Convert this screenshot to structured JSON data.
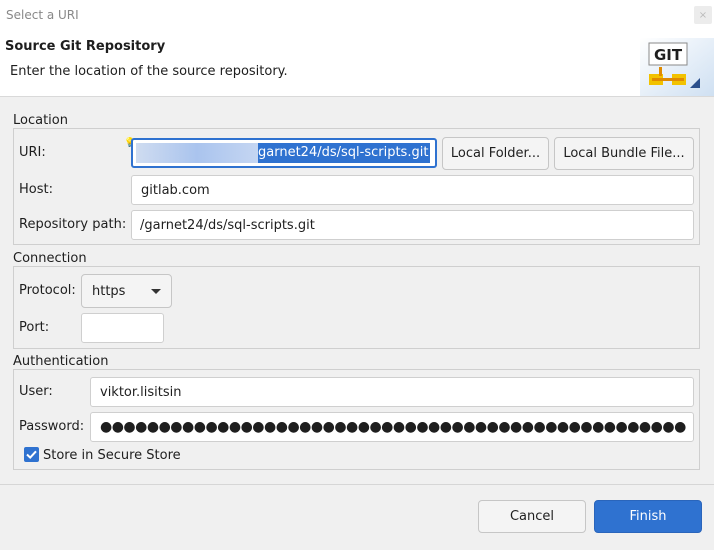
{
  "window": {
    "title": "Select a URI",
    "close_glyph": "×"
  },
  "banner": {
    "heading": "Source Git Repository",
    "description": "Enter the location of the source repository.",
    "logo_text": "GIT",
    "logo_icon": "git-logo-icon"
  },
  "location": {
    "group_title": "Location",
    "uri_label": "URI:",
    "uri_value": "garnet24/ds/sql-scripts.git",
    "local_folder_label": "Local Folder...",
    "local_bundle_label": "Local Bundle File...",
    "host_label": "Host:",
    "host_value": "gitlab.com",
    "repo_path_label": "Repository path:",
    "repo_path_value": "/garnet24/ds/sql-scripts.git"
  },
  "connection": {
    "group_title": "Connection",
    "protocol_label": "Protocol:",
    "protocol_value": "https",
    "port_label": "Port:",
    "port_value": ""
  },
  "authentication": {
    "group_title": "Authentication",
    "user_label": "User:",
    "user_value": "viktor.lisitsin",
    "password_label": "Password:",
    "password_value": "●●●●●●●●●●●●●●●●●●●●●●●●●●●●●●●●●●●●●●●●●●●●●●●●●●",
    "store_label": "Store in Secure Store",
    "store_checked": true
  },
  "footer": {
    "cancel_label": "Cancel",
    "finish_label": "Finish"
  },
  "colors": {
    "accent": "#2f72d0",
    "background": "#f0f0f0"
  }
}
